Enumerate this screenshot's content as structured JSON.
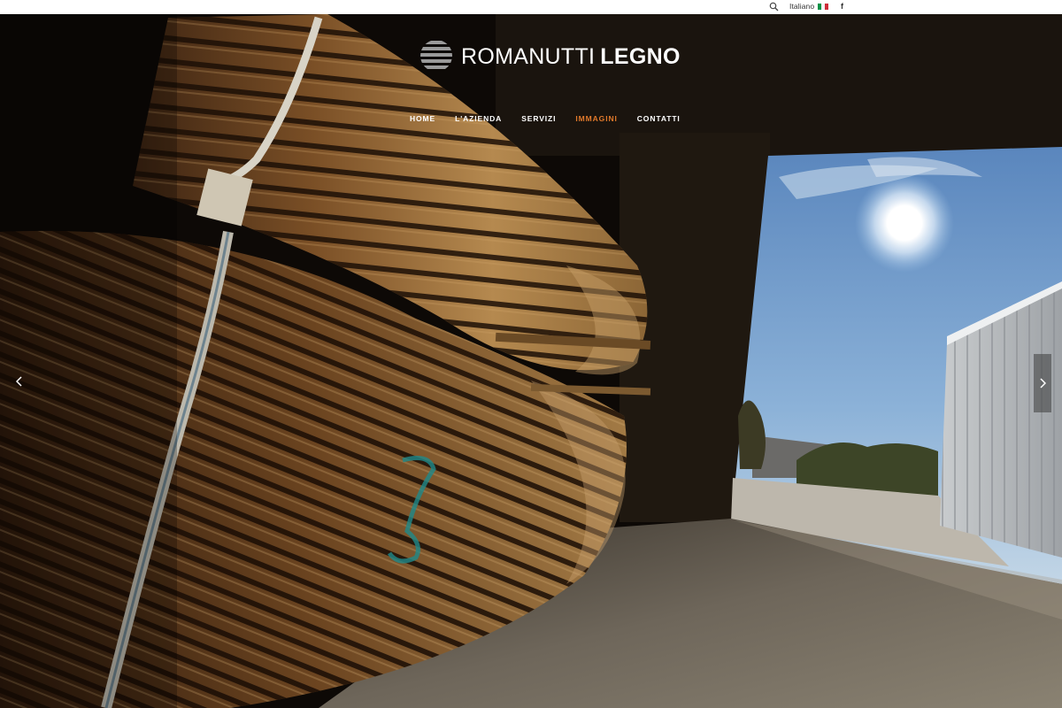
{
  "topbar": {
    "search_icon": "search-icon",
    "language": "Italiano",
    "flag": [
      "#009246",
      "#ffffff",
      "#ce2b37"
    ],
    "facebook": "f"
  },
  "brand": {
    "name_light": "ROMANUTTI",
    "name_bold": "LEGNO",
    "logo_icon": "striped-log-icon"
  },
  "nav": {
    "items": [
      {
        "label": "HOME"
      },
      {
        "label": "L'AZIENDA"
      },
      {
        "label": "SERVIZI"
      },
      {
        "label": "IMMAGINI"
      },
      {
        "label": "CONTATTI"
      }
    ],
    "active": "IMMAGINI",
    "active_color": "#e27a2b"
  },
  "slider": {
    "prev_icon": "chevron-left-icon",
    "next_icon": "chevron-right-icon"
  }
}
